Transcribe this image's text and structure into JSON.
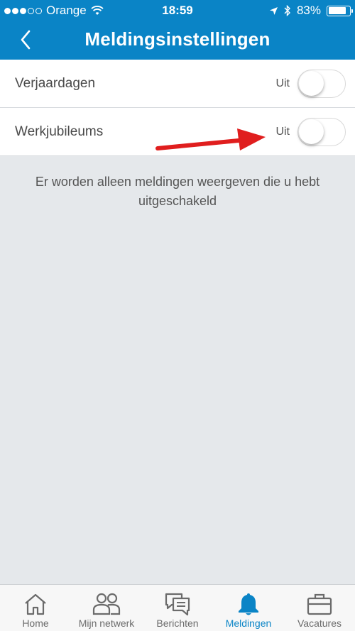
{
  "status_bar": {
    "carrier": "Orange",
    "time": "18:59",
    "battery": "83%",
    "battery_level": 0.83,
    "signal_bars": 3,
    "signal_total": 5
  },
  "header": {
    "title": "Meldingsinstellingen",
    "back_icon": "chevron-left-icon",
    "color": "#0a84c6"
  },
  "settings": [
    {
      "label": "Verjaardagen",
      "state": "Uit",
      "enabled": false
    },
    {
      "label": "Werkjubileums",
      "state": "Uit",
      "enabled": false
    }
  ],
  "info_text": "Er worden alleen meldingen weergeven die u hebt uitgeschakeld",
  "annotation": {
    "color": "#e01e1e",
    "icon": "red-arrow"
  },
  "tabs": [
    {
      "label": "Home",
      "icon": "home-icon",
      "active": false
    },
    {
      "label": "Mijn netwerk",
      "icon": "people-icon",
      "active": false
    },
    {
      "label": "Berichten",
      "icon": "chat-icon",
      "active": false
    },
    {
      "label": "Meldingen",
      "icon": "bell-icon",
      "active": true
    },
    {
      "label": "Vacatures",
      "icon": "briefcase-icon",
      "active": false
    }
  ]
}
